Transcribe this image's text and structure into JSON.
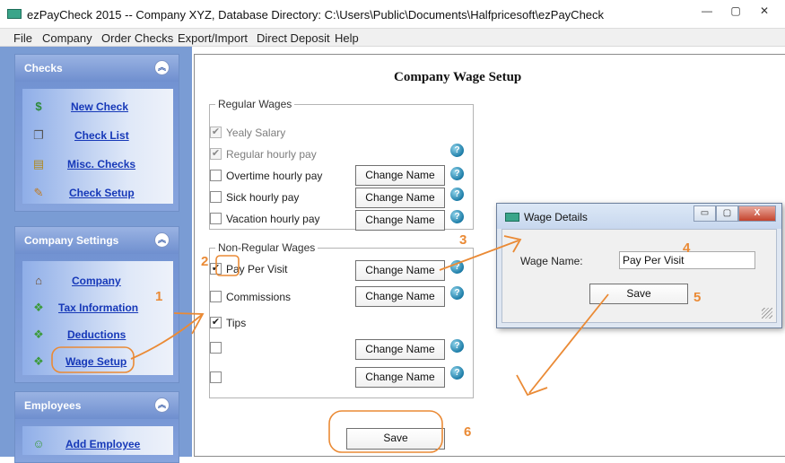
{
  "window": {
    "title": "ezPayCheck 2015 -- Company XYZ, Database Directory: C:\\Users\\Public\\Documents\\Halfpricesoft\\ezPayCheck"
  },
  "menu": [
    "File",
    "Company",
    "Order Checks",
    "Export/Import",
    "Direct Deposit",
    "Help"
  ],
  "sidebar": {
    "checks": {
      "title": "Checks",
      "items": [
        "New Check",
        "Check List",
        "Misc. Checks",
        "Check Setup"
      ]
    },
    "company_settings": {
      "title": "Company Settings",
      "items": [
        "Company",
        "Tax Information",
        "Deductions",
        "Wage Setup"
      ]
    },
    "employees": {
      "title": "Employees",
      "items": [
        "Add Employee"
      ]
    }
  },
  "page": {
    "title": "Company Wage Setup",
    "regular": {
      "label": "Regular Wages",
      "rows": [
        {
          "label": "Yealy Salary",
          "checked": true,
          "disabled": true
        },
        {
          "label": "Regular hourly pay",
          "checked": true,
          "disabled": true
        },
        {
          "label": "Overtime hourly pay",
          "checked": false,
          "disabled": false
        },
        {
          "label": "Sick hourly pay",
          "checked": false,
          "disabled": false
        },
        {
          "label": "Vacation hourly pay",
          "checked": false,
          "disabled": false
        }
      ]
    },
    "nonregular": {
      "label": "Non-Regular Wages",
      "rows": [
        {
          "label": "Pay Per Visit",
          "checked": true
        },
        {
          "label": "Commissions",
          "checked": false
        },
        {
          "label": "Tips",
          "checked": true
        },
        {
          "label": "",
          "checked": false
        },
        {
          "label": "",
          "checked": false
        }
      ]
    },
    "change_name_label": "Change Name",
    "help_glyph": "?",
    "check_glyph": "✔",
    "save_label": "Save"
  },
  "dialog": {
    "title": "Wage Details",
    "wage_name_label": "Wage Name:",
    "wage_name_value": "Pay Per Visit",
    "save_label": "Save",
    "buttons": {
      "minimize": "▭",
      "maximize": "▢",
      "close": "X"
    }
  },
  "titlebar_buttons": {
    "minimize": "—",
    "maximize": "▢",
    "close": "✕"
  },
  "annotations": [
    "1",
    "2",
    "3",
    "4",
    "5",
    "6"
  ],
  "icons": {
    "new_check": "$",
    "check_list": "❐",
    "misc_checks": "▤",
    "check_setup": "✎",
    "company": "⌂",
    "tax_information": "❖",
    "deductions": "❖",
    "wage_setup": "❖",
    "add_employee": "☺"
  },
  "colors": {
    "annotation": "#ea8a35",
    "link": "#1638b8",
    "sidebar": "#7a9cd4"
  }
}
